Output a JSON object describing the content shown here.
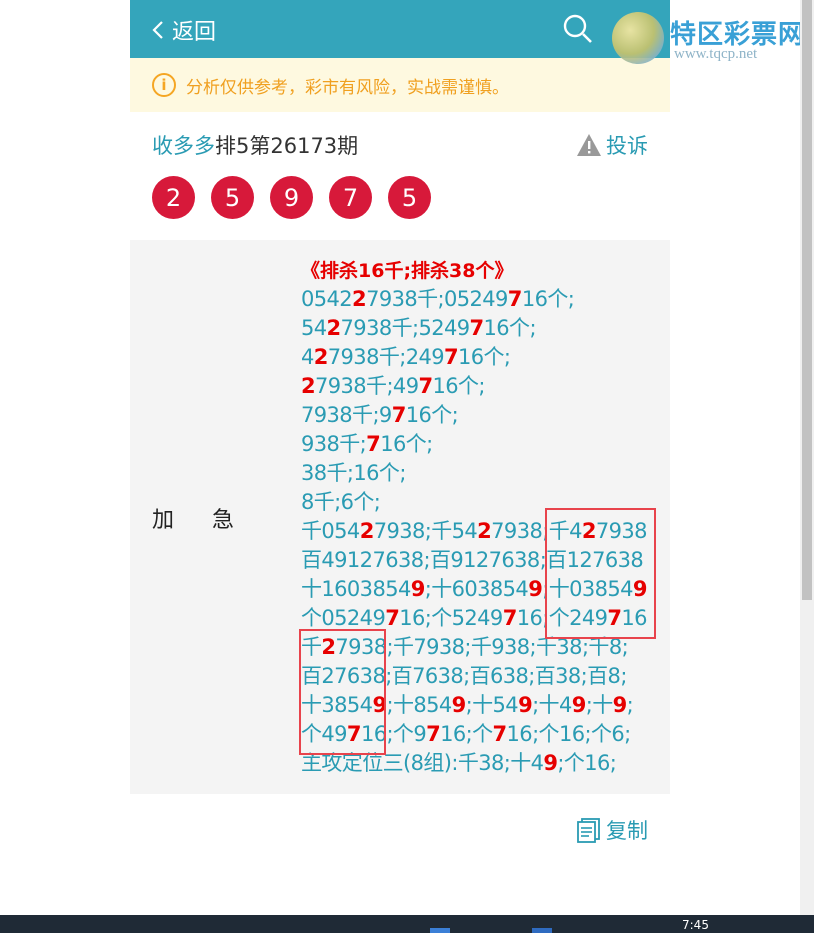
{
  "header": {
    "back_label": "返回"
  },
  "logo": {
    "name": "特区彩票网",
    "url": "www.tqcp.net"
  },
  "notice": {
    "text": "分析仅供参考，彩市有风险，实战需谨慎。"
  },
  "issue": {
    "source": "收多多",
    "title": "排5第26173期"
  },
  "complaint_label": "投诉",
  "balls": [
    "2",
    "5",
    "9",
    "7",
    "5"
  ],
  "row_label": "加急",
  "content": {
    "title": "《排杀16千;排杀38个》",
    "lines": [
      [
        [
          "0542",
          ""
        ],
        [
          "2",
          "r"
        ],
        [
          "7938千;05249",
          ""
        ],
        [
          "7",
          "r"
        ],
        [
          "16个;",
          ""
        ]
      ],
      [
        [
          "54",
          ""
        ],
        [
          "2",
          "r"
        ],
        [
          "7938千;5249",
          ""
        ],
        [
          "7",
          "r"
        ],
        [
          "16个;",
          ""
        ]
      ],
      [
        [
          "4",
          ""
        ],
        [
          "2",
          "r"
        ],
        [
          "7938千;249",
          ""
        ],
        [
          "7",
          "r"
        ],
        [
          "16个;",
          ""
        ]
      ],
      [
        [
          "2",
          "r"
        ],
        [
          "7938千;49",
          ""
        ],
        [
          "7",
          "r"
        ],
        [
          "16个;",
          ""
        ]
      ],
      [
        [
          "7938千;9",
          ""
        ],
        [
          "7",
          "r"
        ],
        [
          "16个;",
          ""
        ]
      ],
      [
        [
          "938千;",
          ""
        ],
        [
          "7",
          "r"
        ],
        [
          "16个;",
          ""
        ]
      ],
      [
        [
          "38千;16个;",
          ""
        ]
      ],
      [
        [
          "8千;6个;",
          ""
        ]
      ],
      [
        [
          "千054",
          ""
        ],
        [
          "2",
          "r"
        ],
        [
          "7938;千54",
          ""
        ],
        [
          "2",
          "r"
        ],
        [
          "7938;千4",
          ""
        ],
        [
          "2",
          "r"
        ],
        [
          "7938",
          ""
        ]
      ],
      [
        [
          "百49127638;百9127638;百127638",
          ""
        ]
      ],
      [
        [
          "十1603854",
          ""
        ],
        [
          "9",
          "r"
        ],
        [
          ";十603854",
          ""
        ],
        [
          "9",
          "r"
        ],
        [
          ";十03854",
          ""
        ],
        [
          "9",
          "r"
        ]
      ],
      [
        [
          "个05249",
          ""
        ],
        [
          "7",
          "r"
        ],
        [
          "16;个5249",
          ""
        ],
        [
          "7",
          "r"
        ],
        [
          "16;个249",
          ""
        ],
        [
          "7",
          "r"
        ],
        [
          "16",
          ""
        ]
      ],
      [
        [
          "千",
          ""
        ],
        [
          "2",
          "r"
        ],
        [
          "7938;千7938;千938;千38;千8;",
          ""
        ]
      ],
      [
        [
          "百27638;百7638;百638;百38;百8;",
          ""
        ]
      ],
      [
        [
          "十3854",
          ""
        ],
        [
          "9",
          "r"
        ],
        [
          ";十854",
          ""
        ],
        [
          "9",
          "r"
        ],
        [
          ";十54",
          ""
        ],
        [
          "9",
          "r"
        ],
        [
          ";十4",
          ""
        ],
        [
          "9",
          "r"
        ],
        [
          ";十",
          ""
        ],
        [
          "9",
          "r"
        ],
        [
          ";",
          ""
        ]
      ],
      [
        [
          "个49",
          ""
        ],
        [
          "7",
          "r"
        ],
        [
          "16;个9",
          ""
        ],
        [
          "7",
          "r"
        ],
        [
          "16;个",
          ""
        ],
        [
          "7",
          "r"
        ],
        [
          "16;个16;个6;",
          ""
        ]
      ],
      [
        [
          "主攻定位三(8组):千38;十4",
          ""
        ],
        [
          "9",
          "r"
        ],
        [
          ";个16;",
          ""
        ]
      ]
    ]
  },
  "copy_label": "复制",
  "taskbar": {
    "clock": "7:45"
  }
}
